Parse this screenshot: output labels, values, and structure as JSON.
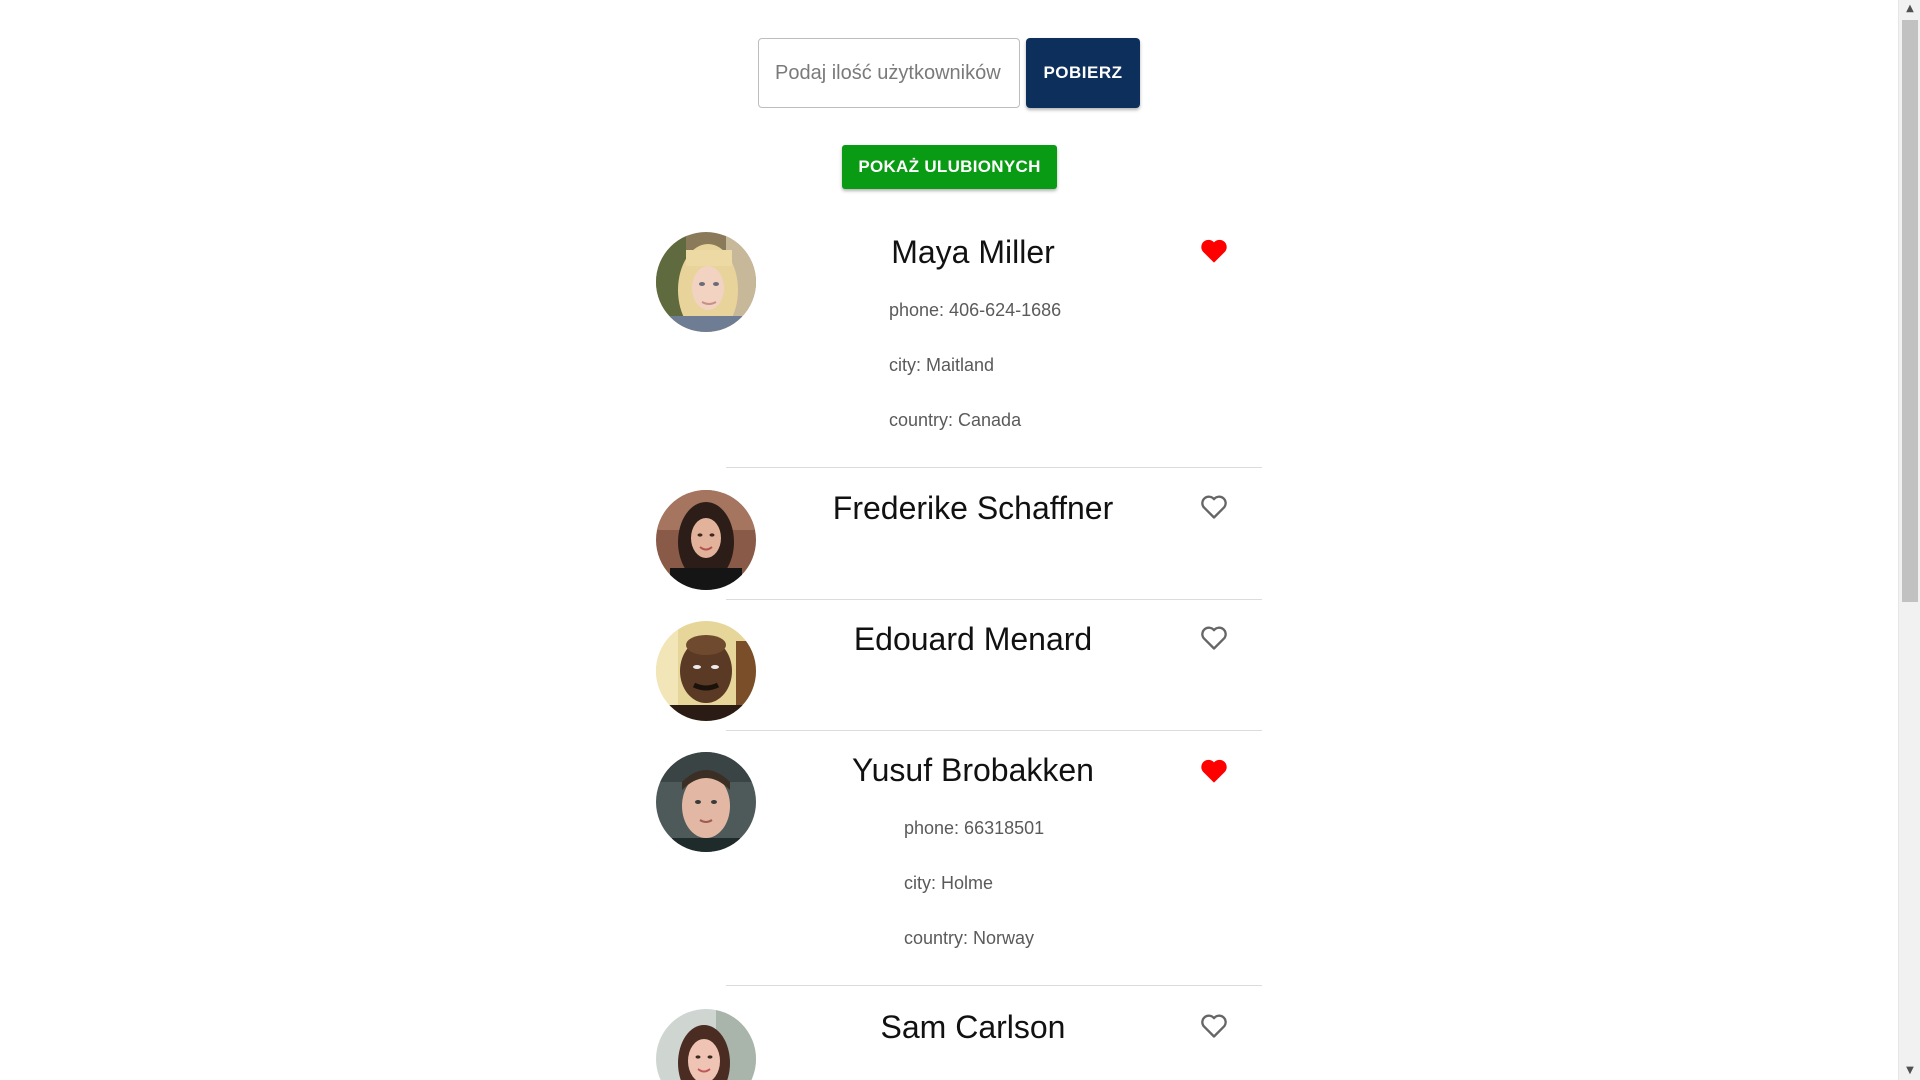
{
  "search": {
    "placeholder": "Podaj ilość użytkowników",
    "value": ""
  },
  "fetch_button": {
    "label": "POBIERZ"
  },
  "favorites_button": {
    "label": "POKAŻ ULUBIONYCH"
  },
  "users": [
    {
      "name": "Maya Miller",
      "favorite": true,
      "phone": "phone: 406-624-1686",
      "city": "city: Maitland",
      "country": "country: Canada"
    },
    {
      "name": "Frederike Schaffner",
      "favorite": false
    },
    {
      "name": "Edouard Menard",
      "favorite": false
    },
    {
      "name": "Yusuf Brobakken",
      "favorite": true,
      "phone": "phone: 66318501",
      "city": "city: Holme",
      "country": "country: Norway"
    },
    {
      "name": "Sam Carlson",
      "favorite": false
    }
  ],
  "colors": {
    "fetch_button": "#0d2f5c",
    "favorites_button": "#0a9b14",
    "heart_filled": "#ff0000",
    "heart_outline": "#666666"
  },
  "icons": {
    "heart_filled": "heart-filled-icon",
    "heart_outline": "heart-outline-icon"
  }
}
